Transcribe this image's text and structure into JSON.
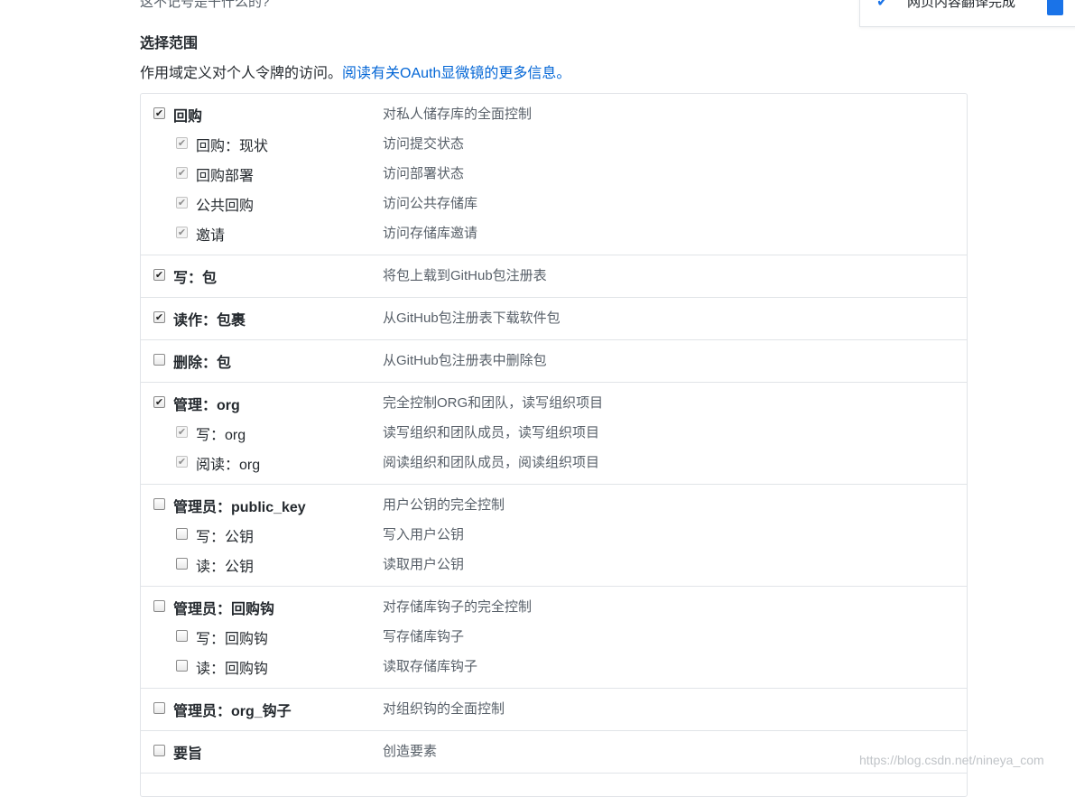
{
  "top_cut_text": "这不记号是干什么的?",
  "popup": {
    "text": "网页内容翻译完成",
    "check_icon": "checkmark-icon",
    "accent_color": "#1a73e8"
  },
  "section": {
    "title": "选择范围",
    "description": "作用域定义对个人令牌的访问。",
    "link_text": "阅读有关OAuth显微镜的更多信息。",
    "link_color": "#0366d6"
  },
  "scope_groups": [
    {
      "parent": {
        "label": "回购",
        "description": "对私人储存库的全面控制",
        "checked": true
      },
      "children": [
        {
          "label": "回购：现状",
          "description": "访问提交状态",
          "checked": true
        },
        {
          "label": "回购部署",
          "description": "访问部署状态",
          "checked": true
        },
        {
          "label": "公共回购",
          "description": "访问公共存储库",
          "checked": true
        },
        {
          "label": "邀请",
          "description": "访问存储库邀请",
          "checked": true
        }
      ]
    },
    {
      "parent": {
        "label": "写：包",
        "description": "将包上载到GitHub包注册表",
        "checked": true
      },
      "children": []
    },
    {
      "parent": {
        "label": "读作：包裹",
        "description": "从GitHub包注册表下载软件包",
        "checked": true
      },
      "children": []
    },
    {
      "parent": {
        "label": "删除：包",
        "description": "从GitHub包注册表中删除包",
        "checked": false
      },
      "children": []
    },
    {
      "parent": {
        "label": "管理：org",
        "description": "完全控制ORG和团队，读写组织项目",
        "checked": true
      },
      "children": [
        {
          "label": "写：org",
          "description": "读写组织和团队成员，读写组织项目",
          "checked": true
        },
        {
          "label": "阅读：org",
          "description": "阅读组织和团队成员，阅读组织项目",
          "checked": true
        }
      ]
    },
    {
      "parent": {
        "label": "管理员：public_key",
        "description": "用户公钥的完全控制",
        "checked": false
      },
      "children": [
        {
          "label": "写：公钥",
          "description": "写入用户公钥",
          "checked": false
        },
        {
          "label": "读：公钥",
          "description": "读取用户公钥",
          "checked": false
        }
      ]
    },
    {
      "parent": {
        "label": "管理员：回购钩",
        "description": "对存储库钩子的完全控制",
        "checked": false
      },
      "children": [
        {
          "label": "写：回购钩",
          "description": "写存储库钩子",
          "checked": false
        },
        {
          "label": "读：回购钩",
          "description": "读取存储库钩子",
          "checked": false
        }
      ]
    },
    {
      "parent": {
        "label": "管理员：org_钩子",
        "description": "对组织钩的全面控制",
        "checked": false
      },
      "children": []
    },
    {
      "parent": {
        "label": "要旨",
        "description": "创造要素",
        "checked": false
      },
      "children": []
    }
  ],
  "watermark": "https://blog.csdn.net/nineya_com"
}
